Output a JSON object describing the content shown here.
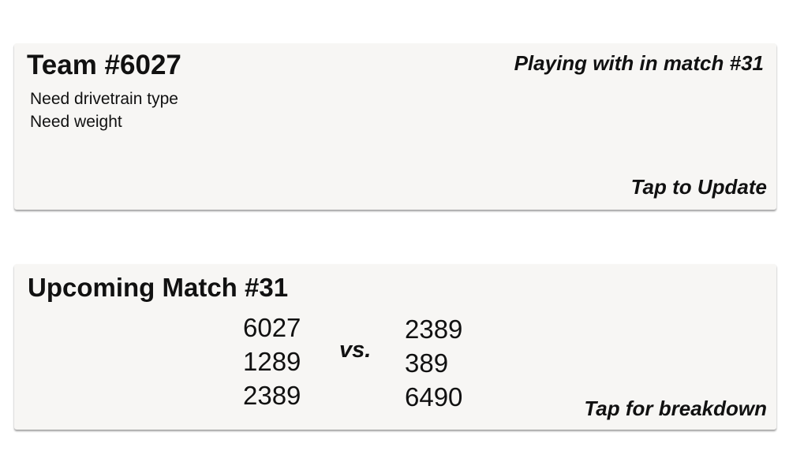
{
  "team_card": {
    "title": "Team #6027",
    "playing_with": "Playing with in match #31",
    "needs": [
      "Need drivetrain type",
      "Need weight"
    ],
    "action": "Tap to Update"
  },
  "match_card": {
    "title": "Upcoming Match #31",
    "alliance_a": [
      "6027",
      "1289",
      "2389"
    ],
    "versus": "vs.",
    "alliance_b": [
      "2389",
      "389",
      "6490"
    ],
    "action": "Tap for breakdown"
  }
}
